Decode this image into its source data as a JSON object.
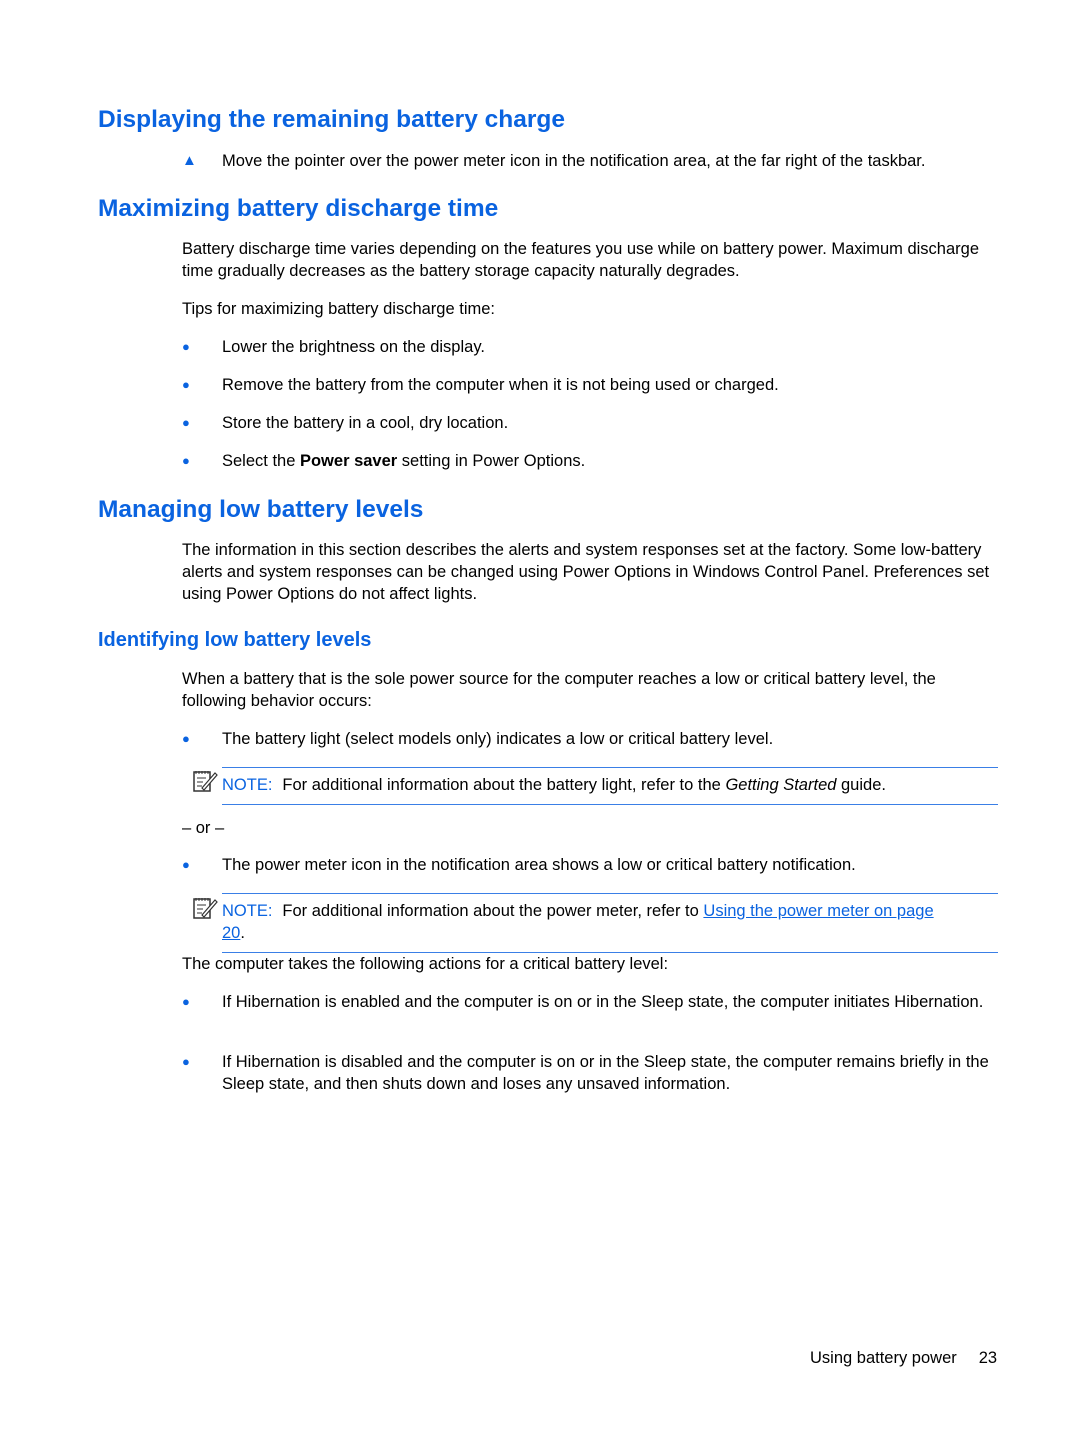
{
  "colors": {
    "accent": "#0a63e0",
    "text": "#000000"
  },
  "sections": {
    "displaying": {
      "title": "Displaying the remaining battery charge",
      "step_marker": "▲",
      "step_text": "Move the pointer over the power meter icon in the notification area, at the far right of the taskbar."
    },
    "maximizing": {
      "title": "Maximizing battery discharge time",
      "intro": "Battery discharge time varies depending on the features you use while on battery power. Maximum discharge time gradually decreases as the battery storage capacity naturally degrades.",
      "tips_label": "Tips for maximizing battery discharge time:",
      "tips": [
        {
          "text": "Lower the brightness on the display."
        },
        {
          "text": "Remove the battery from the computer when it is not being used or charged."
        },
        {
          "text": "Store the battery in a cool, dry location."
        },
        {
          "pre": "Select the ",
          "bold": "Power saver",
          "post": " setting in Power Options."
        }
      ]
    },
    "managing": {
      "title": "Managing low battery levels",
      "intro": "The information in this section describes the alerts and system responses set at the factory. Some low-battery alerts and system responses can be changed using Power Options in Windows Control Panel. Preferences set using Power Options do not affect lights."
    },
    "identifying": {
      "title": "Identifying low battery levels",
      "intro": "When a battery that is the sole power source for the computer reaches a low or critical battery level, the following behavior occurs:",
      "bullet1": "The battery light (select models only) indicates a low or critical battery level.",
      "note1": {
        "label": "NOTE:",
        "pre": "For additional information about the battery light, refer to the ",
        "italic": "Getting Started",
        "post": " guide."
      },
      "or_text": "– or –",
      "bullet2": "The power meter icon in the notification area shows a low or critical battery notification.",
      "note2": {
        "label": "NOTE:",
        "pre": "For additional information about the power meter, refer to ",
        "link": "Using the power meter on page 20",
        "post": "."
      },
      "critical_label": "The computer takes the following actions for a critical battery level:",
      "critical_actions": [
        "If Hibernation is enabled and the computer is on or in the Sleep state, the computer initiates Hibernation.",
        "If Hibernation is disabled and the computer is on or in the Sleep state, the computer remains briefly in the Sleep state, and then shuts down and loses any unsaved information."
      ]
    }
  },
  "bullet_marker": "●",
  "icons": {
    "note": "note-pad-pencil-icon"
  },
  "footer": {
    "chapter": "Using battery power",
    "page": "23"
  }
}
